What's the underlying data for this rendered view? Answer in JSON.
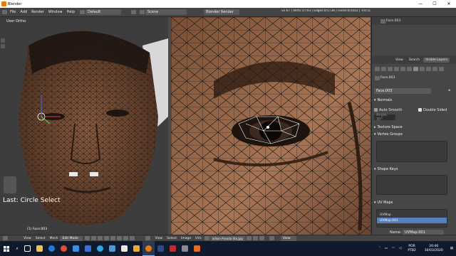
{
  "window": {
    "title": "Blender",
    "min": "—",
    "max": "☐",
    "close": "✕"
  },
  "topbar": {
    "menus": [
      "File",
      "Add",
      "Render",
      "Window",
      "Help"
    ],
    "layout": "Default",
    "scene": "Scene",
    "engine": "Blender Render",
    "stats": "v2.67 | Verts:1/743 | Edges:0/1738 | Faces:0/1022 | Tris:1022 | Ob... | Face.003"
  },
  "viewport3d": {
    "view_label": "User Ortho",
    "last_operator": "Last: Circle Select",
    "object_label": "(1) Face.003",
    "menus": [
      "View",
      "Select",
      "Mesh"
    ],
    "mode": "Edit Mode"
  },
  "uv_editor": {
    "menus": [
      "View",
      "Select",
      "Image",
      "UVs"
    ],
    "image_name": "adson Posada Sto.jpg",
    "view_menu": "View"
  },
  "properties": {
    "breadcrumb": "Face.003",
    "header_tabs": [
      "View",
      "Search",
      "All Scenes",
      "Visible Layers"
    ],
    "object_name": "Face.003",
    "mesh_name": "Face.003",
    "sections": {
      "normals": "Normals",
      "auto_smooth": "Auto Smooth",
      "double_sided": "Double Sided",
      "angle": "Angle: 30°",
      "texture_space": "Texture Space",
      "vertex_groups": "Vertex Groups",
      "shape_keys": "Shape Keys",
      "uv_maps": "UV Maps",
      "vertex_colors": "Vertex Colors"
    },
    "uv_maps": [
      "UVMap",
      "UVMap.001"
    ],
    "name_label": "Name:",
    "name_value": "UVMap.001"
  },
  "taskbar": {
    "lang": "POR",
    "lang2": "PTB2",
    "time": "20:46",
    "date": "30/03/2020"
  },
  "colors": {
    "accent_blue": "#5680c2",
    "blender_orange": "#e87d0d",
    "taskbar": "#0f1b2d"
  }
}
